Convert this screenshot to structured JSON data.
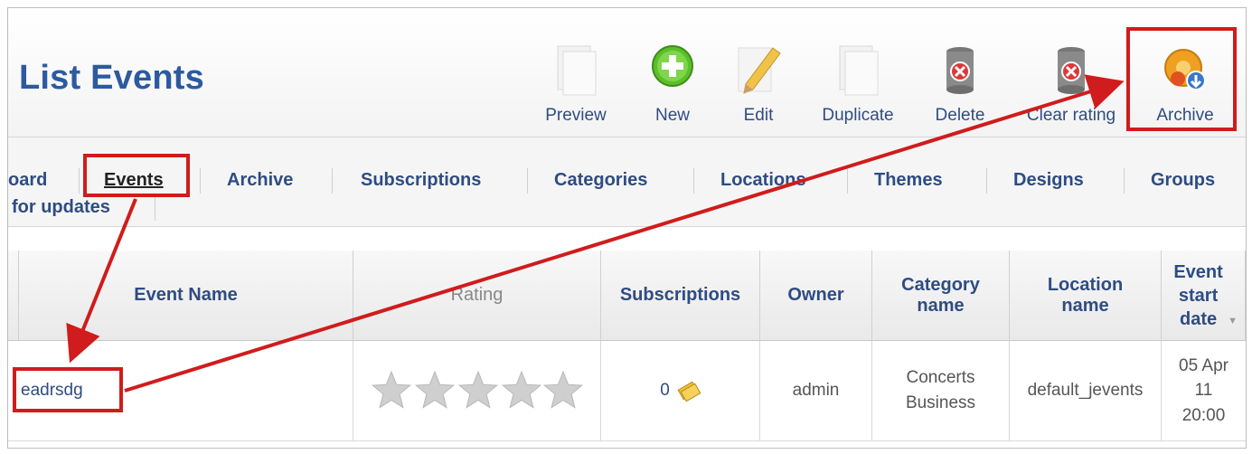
{
  "page_title": "List Events",
  "toolbar": {
    "preview": "Preview",
    "new": "New",
    "edit": "Edit",
    "duplicate": "Duplicate",
    "delete": "Delete",
    "clear_rating": "Clear rating",
    "archive": "Archive"
  },
  "nav": {
    "dashboard_fragment": "oard",
    "events": "Events",
    "archive": "Archive",
    "subscriptions": "Subscriptions",
    "categories": "Categories",
    "locations": "Locations",
    "themes": "Themes",
    "designs": "Designs",
    "groups": "Groups",
    "check_updates_fragment": "for updates"
  },
  "table": {
    "headers": {
      "event_name": "Event Name",
      "rating": "Rating",
      "subscriptions": "Subscriptions",
      "owner": "Owner",
      "category_name": "Category name",
      "location_name": "Location name",
      "event_start_date": "Event start date"
    },
    "rows": [
      {
        "event_name": "eadrsdg",
        "rating_stars": 0,
        "rating_max": 5,
        "subscriptions": "0",
        "owner": "admin",
        "category_line1": "Concerts",
        "category_line2": "Business",
        "location": "default_jevents",
        "date_line1": "05 Apr",
        "date_line2": "11",
        "date_line3": "20:00"
      }
    ]
  },
  "icons": {
    "preview": "page-icon",
    "new": "plus-circle-icon",
    "edit": "pencil-icon",
    "duplicate": "pages-icon",
    "delete": "trash-delete-icon",
    "clear_rating": "trash-clear-icon",
    "archive": "archive-icon"
  },
  "colors": {
    "link": "#2e4c83",
    "title": "#2c5aa0",
    "highlight": "#d01c1c"
  }
}
